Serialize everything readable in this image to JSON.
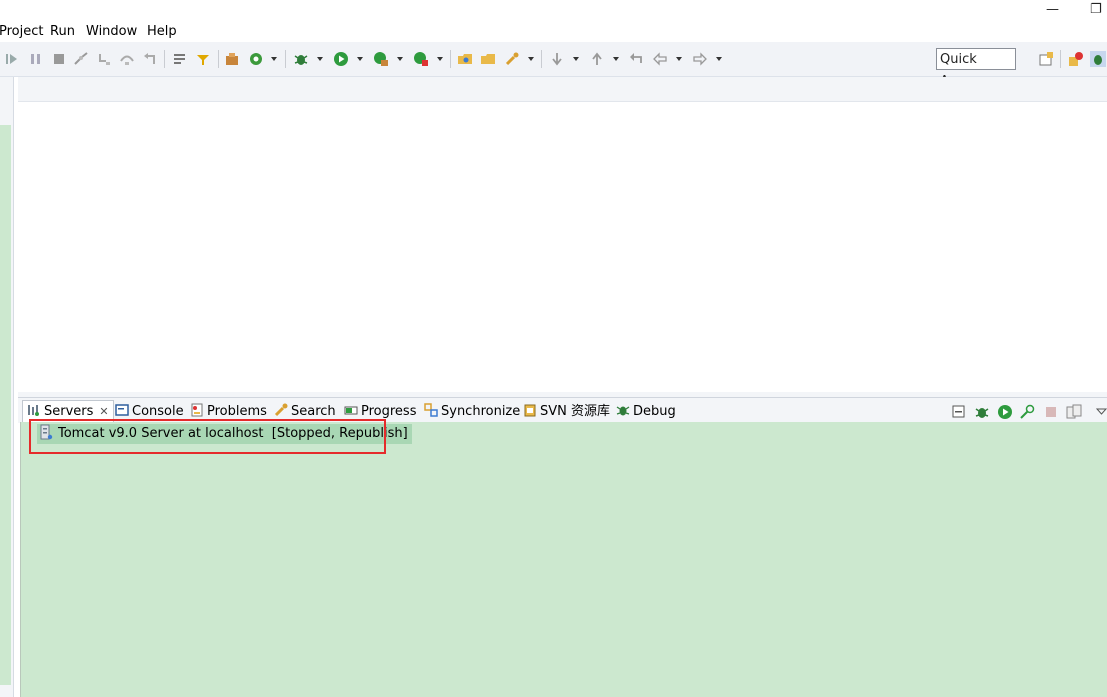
{
  "menu": {
    "items": [
      "Project",
      "Run",
      "Window",
      "Help"
    ],
    "minimize_glyph": "—",
    "restore_glyph": "❐"
  },
  "toolbar": {
    "quick_access_label": "Quick Access"
  },
  "panel": {
    "tabs": [
      {
        "label": "Servers",
        "icon": "servers-icon",
        "active": true
      },
      {
        "label": "Console",
        "icon": "console-icon"
      },
      {
        "label": "Problems",
        "icon": "problems-icon"
      },
      {
        "label": "Search",
        "icon": "search-icon"
      },
      {
        "label": "Progress",
        "icon": "progress-icon"
      },
      {
        "label": "Synchronize",
        "icon": "synchronize-icon"
      },
      {
        "label": "SVN 资源库",
        "icon": "svn-repository-icon"
      },
      {
        "label": "Debug",
        "icon": "debug-icon"
      }
    ],
    "close_glyph": "✕",
    "server": {
      "name": "Tomcat v9.0 Server at localhost",
      "status": "[Stopped, Republish]",
      "icon": "server-icon"
    }
  },
  "colors": {
    "panel_background": "#cce8cf",
    "selection": "#a9d7b4",
    "highlight_border": "#e52b2b",
    "toolbar_background": "#f1f3f7"
  }
}
